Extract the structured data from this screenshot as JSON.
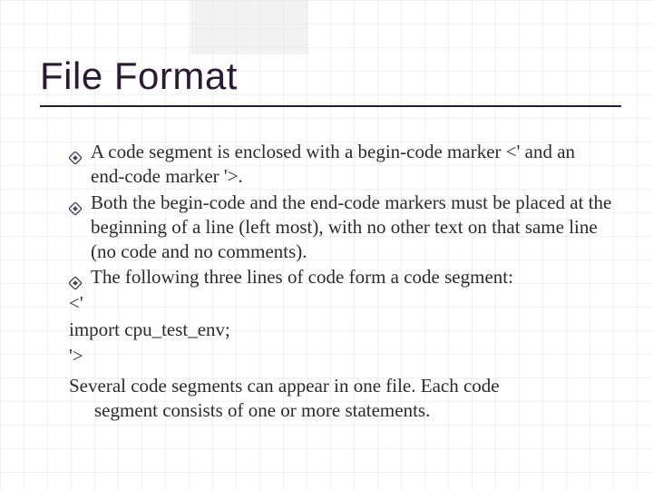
{
  "title": "File Format",
  "bullets": [
    "A code segment is enclosed with a begin-code marker <' and an end-code marker '>.",
    "Both the begin-code and the end-code markers must be placed at the beginning of a line (left most), with no other text on that same line (no code and no comments).",
    "The following three lines of code form a code segment:"
  ],
  "code_lines": [
    "<'",
    "import cpu_test_env;",
    "'>"
  ],
  "closing": {
    "first": "Several code segments can appear in one file. Each code",
    "cont": "segment consists of one or more statements."
  }
}
